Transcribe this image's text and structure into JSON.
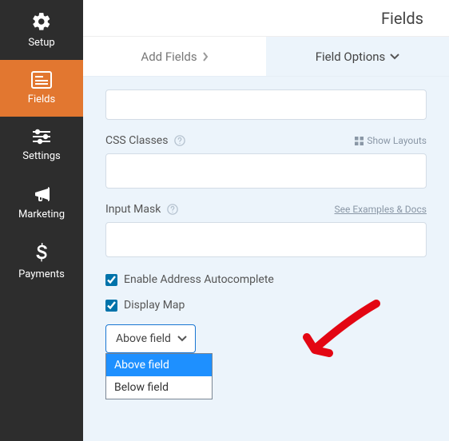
{
  "header": {
    "title": "Fields"
  },
  "sidebar": {
    "items": [
      {
        "label": "Setup"
      },
      {
        "label": "Fields"
      },
      {
        "label": "Settings"
      },
      {
        "label": "Marketing"
      },
      {
        "label": "Payments"
      }
    ]
  },
  "tabs": {
    "add": "Add Fields",
    "options": "Field Options"
  },
  "fields": {
    "css": {
      "label": "CSS Classes",
      "hint": "Show Layouts"
    },
    "mask": {
      "label": "Input Mask",
      "hint": "See Examples & Docs"
    },
    "autocomplete": {
      "label": "Enable Address Autocomplete"
    },
    "display_map": {
      "label": "Display Map"
    },
    "position": {
      "selected": "Above field",
      "options": [
        "Above field",
        "Below field"
      ]
    }
  }
}
